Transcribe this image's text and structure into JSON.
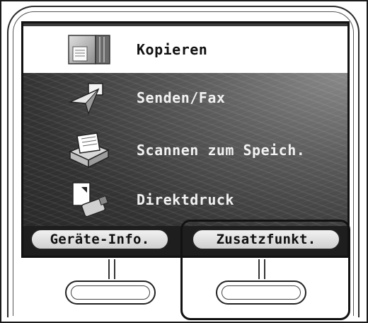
{
  "menu": {
    "items": [
      {
        "label": "Kopieren",
        "icon": "copy-icon",
        "selected": true
      },
      {
        "label": "Senden/Fax",
        "icon": "send-icon",
        "selected": false
      },
      {
        "label": "Scannen zum Speich.",
        "icon": "scan-icon",
        "selected": false
      },
      {
        "label": "Direktdruck",
        "icon": "direct-print-icon",
        "selected": false
      }
    ]
  },
  "softkeys": {
    "left_label": "Geräte-Info.",
    "right_label": "Zusatzfunkt."
  },
  "colors": {
    "screen_background": "#3c3c3c",
    "selected_row": "#ffffff",
    "text_light": "#f2f2f2",
    "text_dark": "#111111"
  }
}
